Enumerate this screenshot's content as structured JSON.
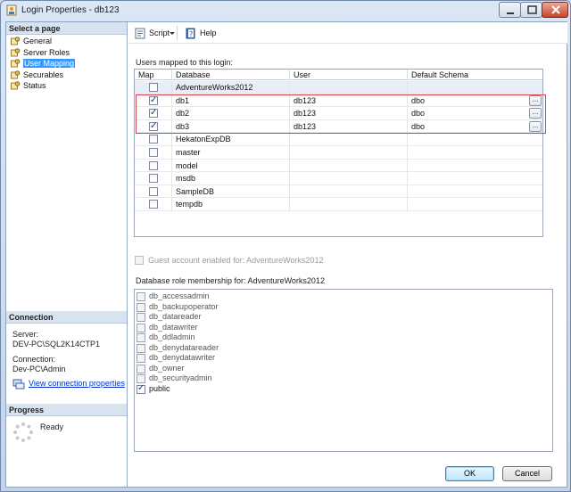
{
  "window": {
    "title": "Login Properties - db123"
  },
  "left_pane": {
    "select_page_header": "Select a page",
    "pages": [
      {
        "label": "General",
        "icon": "page-settings-icon",
        "selected": false
      },
      {
        "label": "Server Roles",
        "icon": "page-settings-icon",
        "selected": false
      },
      {
        "label": "User Mapping",
        "icon": "page-settings-icon",
        "selected": true
      },
      {
        "label": "Securables",
        "icon": "page-settings-icon",
        "selected": false
      },
      {
        "label": "Status",
        "icon": "page-settings-icon",
        "selected": false
      }
    ],
    "connection_header": "Connection",
    "server_label": "Server:",
    "server_value": "DEV-PC\\SQL2K14CTP1",
    "connection_label": "Connection:",
    "connection_value": "Dev-PC\\Admin",
    "view_connection_link": "View connection properties",
    "progress_header": "Progress",
    "progress_status": "Ready"
  },
  "toolbar": {
    "script_label": "Script",
    "help_label": "Help"
  },
  "users_mapped": {
    "label": "Users mapped to this login:",
    "columns": [
      "Map",
      "Database",
      "User",
      "Default Schema"
    ],
    "rows": [
      {
        "map": false,
        "database": "AdventureWorks2012",
        "user": "",
        "schema": "",
        "header": true
      },
      {
        "map": true,
        "database": "db1",
        "user": "db123",
        "schema": "dbo",
        "has_browse": true
      },
      {
        "map": true,
        "database": "db2",
        "user": "db123",
        "schema": "dbo",
        "has_browse": true
      },
      {
        "map": true,
        "database": "db3",
        "user": "db123",
        "schema": "dbo",
        "has_browse": true
      },
      {
        "map": false,
        "database": "HekatonExpDB",
        "user": "",
        "schema": ""
      },
      {
        "map": false,
        "database": "master",
        "user": "",
        "schema": ""
      },
      {
        "map": false,
        "database": "model",
        "user": "",
        "schema": ""
      },
      {
        "map": false,
        "database": "msdb",
        "user": "",
        "schema": ""
      },
      {
        "map": false,
        "database": "SampleDB",
        "user": "",
        "schema": ""
      },
      {
        "map": false,
        "database": "tempdb",
        "user": "",
        "schema": ""
      }
    ],
    "browse_label": "..."
  },
  "guest_account": {
    "label": "Guest account enabled for: AdventureWorks2012",
    "checked": false,
    "enabled": false
  },
  "role_membership": {
    "label": "Database role membership for: AdventureWorks2012",
    "roles": [
      {
        "name": "db_accessadmin",
        "checked": false
      },
      {
        "name": "db_backupoperator",
        "checked": false
      },
      {
        "name": "db_datareader",
        "checked": false
      },
      {
        "name": "db_datawriter",
        "checked": false
      },
      {
        "name": "db_ddladmin",
        "checked": false
      },
      {
        "name": "db_denydatareader",
        "checked": false
      },
      {
        "name": "db_denydatawriter",
        "checked": false
      },
      {
        "name": "db_owner",
        "checked": false
      },
      {
        "name": "db_securityadmin",
        "checked": false
      },
      {
        "name": "public",
        "checked": true
      }
    ]
  },
  "buttons": {
    "ok": "OK",
    "cancel": "Cancel"
  },
  "colors": {
    "selection": "#3399ff",
    "highlight_border": "#d9404b",
    "link": "#0033cc"
  }
}
